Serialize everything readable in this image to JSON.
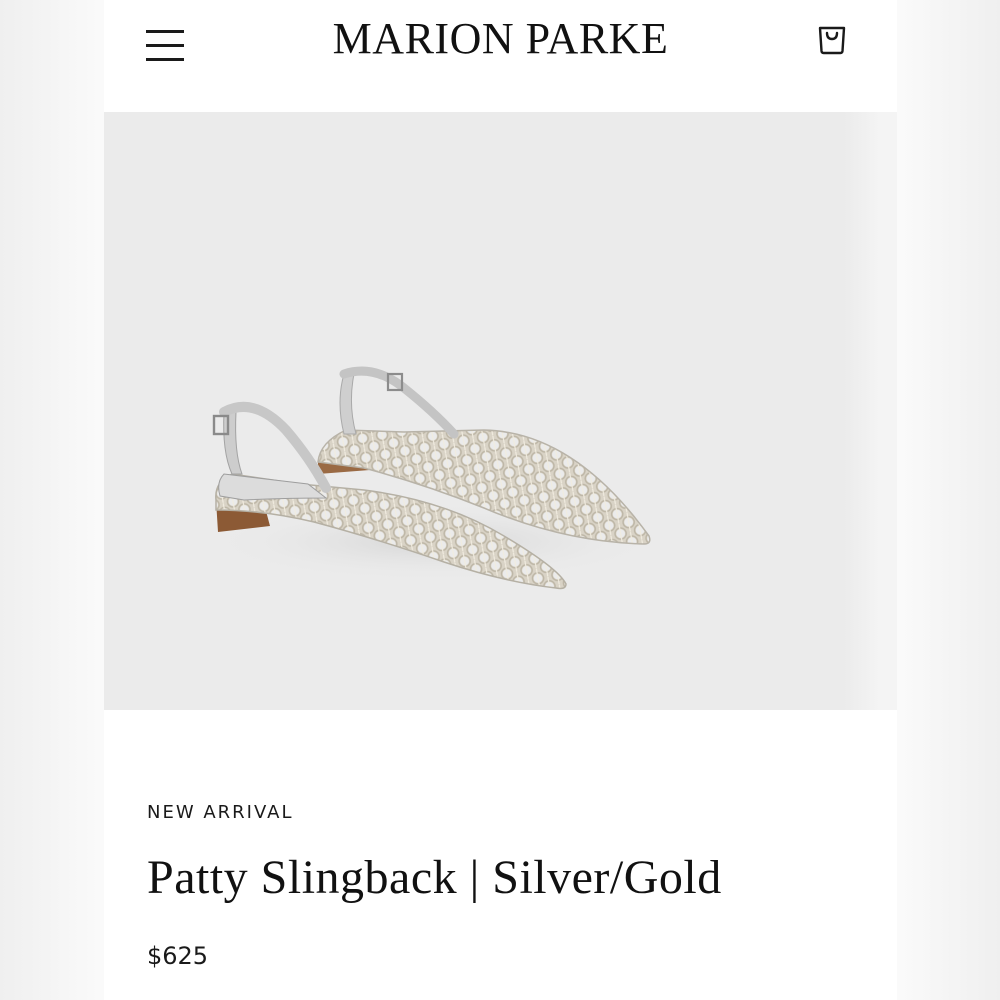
{
  "header": {
    "brand": "MARION PARKE",
    "menu_icon": "hamburger-menu-icon",
    "cart_icon": "shopping-bag-icon"
  },
  "product": {
    "badge": "NEW ARRIVAL",
    "title": "Patty Slingback | Silver/Gold",
    "price": "$625",
    "image_alt": "Woven silver and gold pointed-toe slingback flats"
  },
  "colors": {
    "text": "#111111",
    "hero_background": "#ebebeb",
    "page_background": "#ffffff"
  }
}
